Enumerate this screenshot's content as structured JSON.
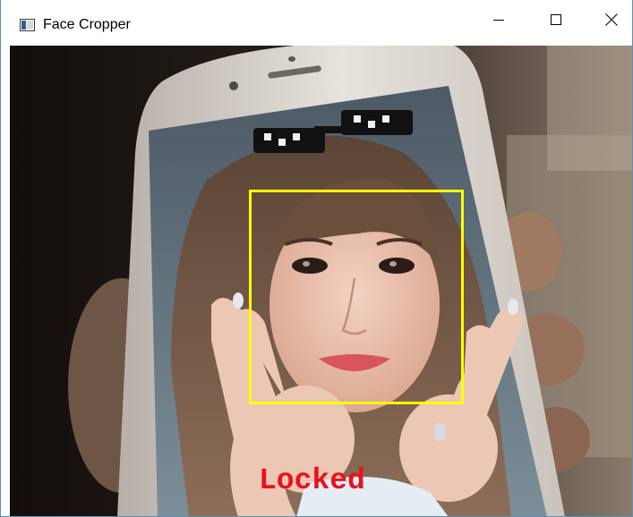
{
  "window": {
    "title": "Face Cropper",
    "controls": {
      "minimize": "minimize",
      "maximize": "maximize",
      "close": "close"
    }
  },
  "video": {
    "status_label": "Locked",
    "colors": {
      "face_box": "#ffff00",
      "status_text": "#e8121d"
    }
  }
}
